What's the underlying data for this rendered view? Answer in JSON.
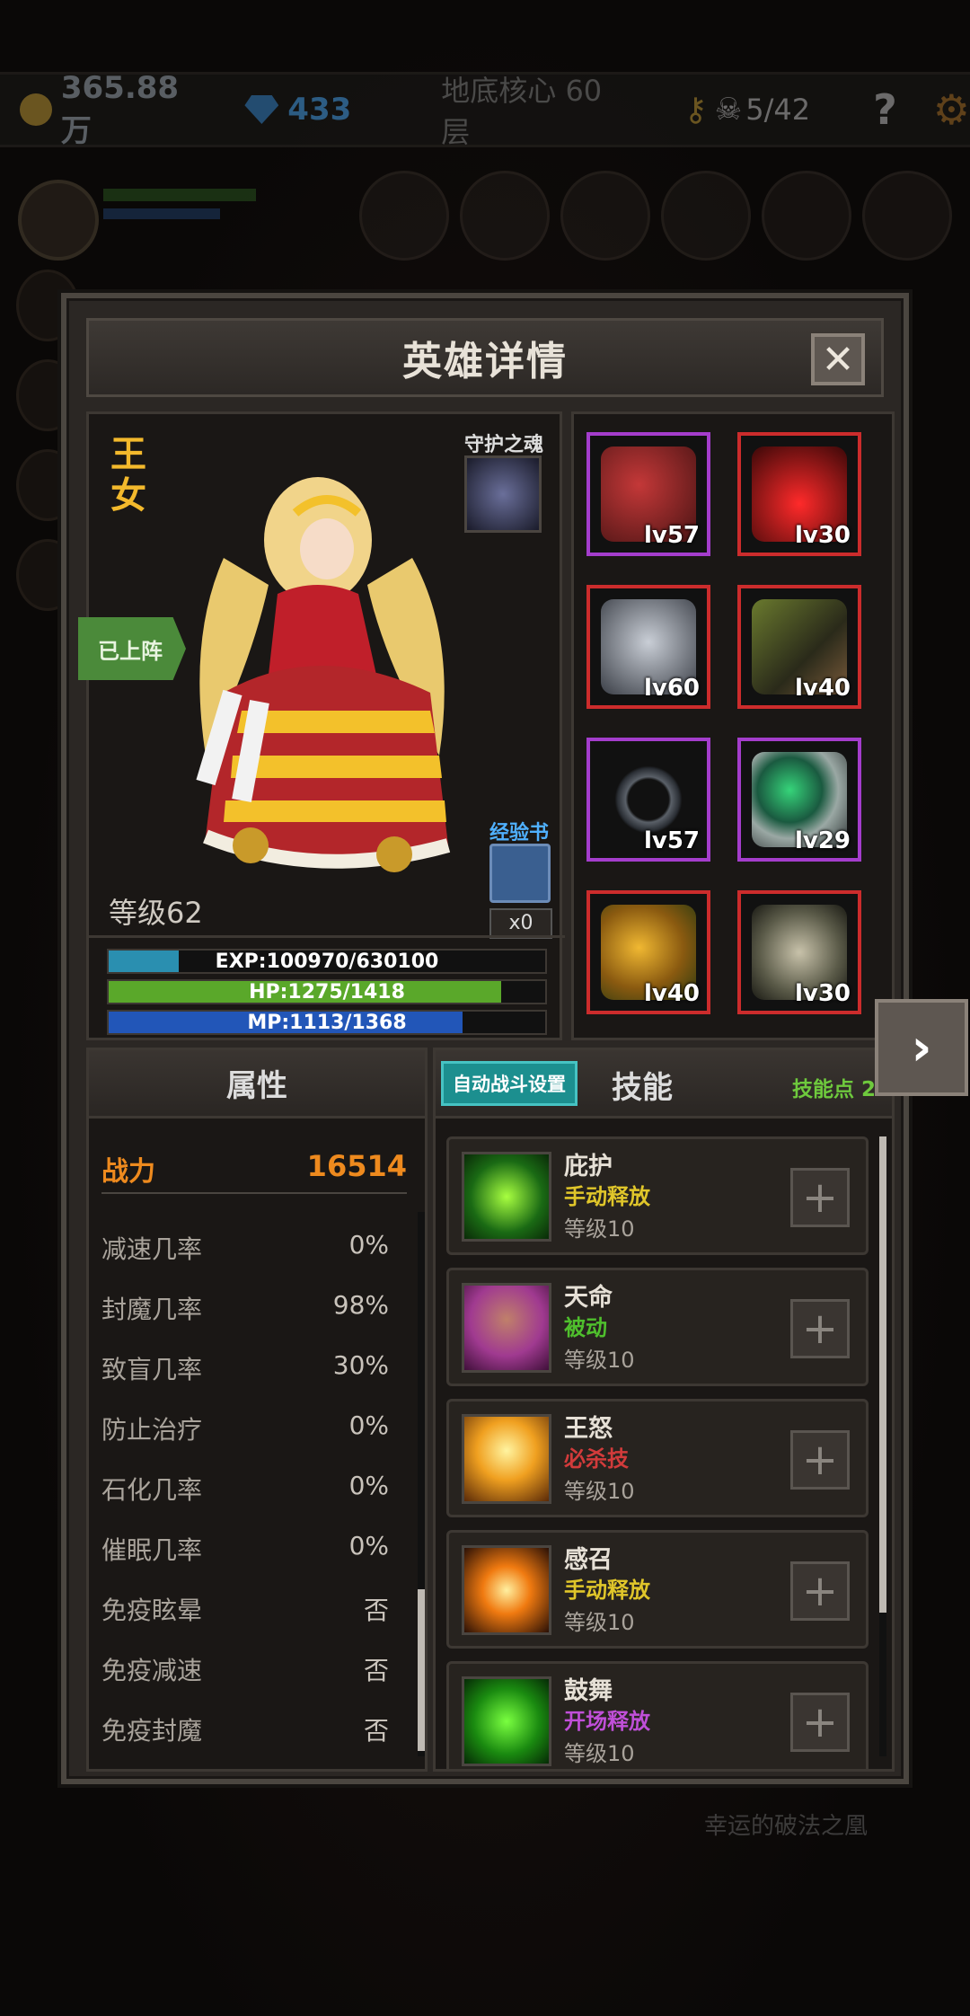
{
  "topbar": {
    "gold": "365.88万",
    "gems": "433",
    "floor": "地底核心 60层",
    "skull_count": "5/42",
    "help_label": "?"
  },
  "background": {
    "lucky_text": "幸运的破法之凰"
  },
  "dialog": {
    "title": "英雄详情",
    "close_label": "✕"
  },
  "hero": {
    "name": "王女",
    "guardian_label": "守护之魂",
    "status_badge": "已上阵",
    "level_text": "等级62",
    "exp_book_label": "经验书",
    "exp_book_count": "x0",
    "exp_text": "EXP:100970/630100",
    "exp_fraction": 0.16,
    "hp_text": "HP:1275/1418",
    "hp_fraction": 0.9,
    "mp_text": "MP:1113/1368",
    "mp_fraction": 0.81
  },
  "equipment": [
    {
      "name": "helmet-icon",
      "level": "lv57",
      "rarity": "purple"
    },
    {
      "name": "amulet-icon",
      "level": "lv30",
      "rarity": "red"
    },
    {
      "name": "armor-icon",
      "level": "lv60",
      "rarity": "red"
    },
    {
      "name": "boots-icon",
      "level": "lv40",
      "rarity": "red"
    },
    {
      "name": "ring-icon",
      "level": "lv57",
      "rarity": "purple"
    },
    {
      "name": "emerald-ring-icon",
      "level": "lv29",
      "rarity": "purple"
    },
    {
      "name": "seed-icon",
      "level": "lv40",
      "rarity": "red"
    },
    {
      "name": "horn-icon",
      "level": "lv30",
      "rarity": "red"
    }
  ],
  "attributes": {
    "header": "属性",
    "power_label": "战力",
    "power_value": "16514",
    "rows": [
      {
        "label": "减速几率",
        "value": "0%"
      },
      {
        "label": "封魔几率",
        "value": "98%"
      },
      {
        "label": "致盲几率",
        "value": "30%"
      },
      {
        "label": "防止治疗",
        "value": "0%"
      },
      {
        "label": "石化几率",
        "value": "0%"
      },
      {
        "label": "催眠几率",
        "value": "0%"
      },
      {
        "label": "免疫眩晕",
        "value": "否"
      },
      {
        "label": "免疫减速",
        "value": "否"
      },
      {
        "label": "免疫封魔",
        "value": "否"
      }
    ]
  },
  "skills": {
    "auto_battle_label": "自动战斗设置",
    "header": "技能",
    "points": "技能点 2",
    "items": [
      {
        "name": "庇护",
        "type": "手动释放",
        "type_color": "#e0c62a",
        "level": "等级10"
      },
      {
        "name": "天命",
        "type": "被动",
        "type_color": "#4fbf2d",
        "level": "等级10"
      },
      {
        "name": "王怒",
        "type": "必杀技",
        "type_color": "#d23b3b",
        "level": "等级10"
      },
      {
        "name": "感召",
        "type": "手动释放",
        "type_color": "#e0c62a",
        "level": "等级10"
      },
      {
        "name": "鼓舞",
        "type": "开场释放",
        "type_color": "#c04fd8",
        "level": "等级10"
      }
    ]
  },
  "colors": {
    "exp_fill": "#2a8fb0",
    "hp_fill": "#5aa82a",
    "mp_fill": "#2256b8",
    "accent_orange": "#ee8a1e"
  }
}
